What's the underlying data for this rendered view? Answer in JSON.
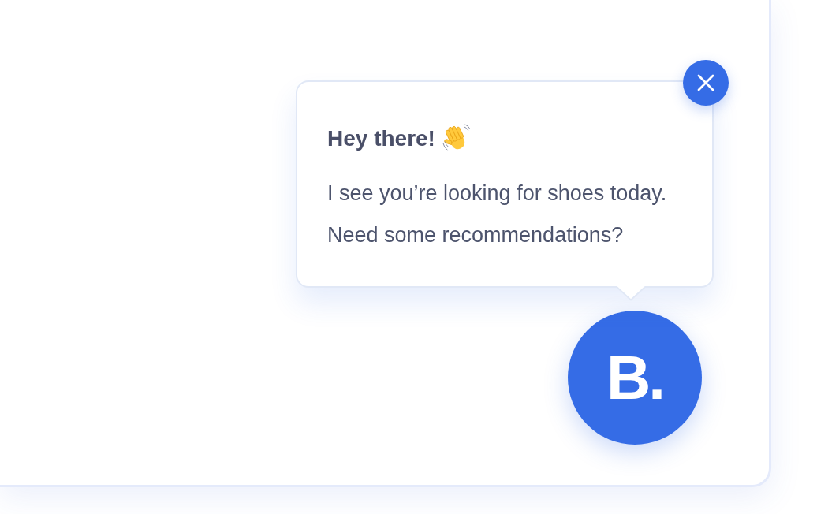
{
  "chat_popup": {
    "title": "Hey there!",
    "messages": [
      "I see you’re looking for shoes today.",
      "Need some recommendations?"
    ]
  },
  "launcher": {
    "logo_text": "B."
  }
}
